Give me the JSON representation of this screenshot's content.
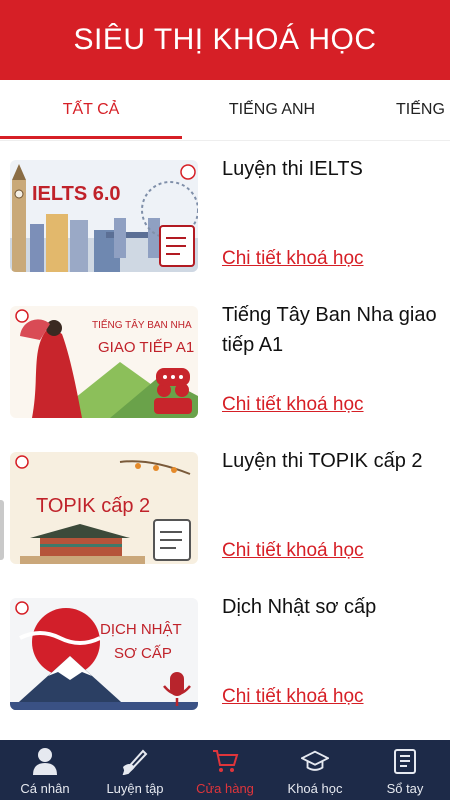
{
  "header": {
    "title": "SIÊU THỊ KHOÁ HỌC"
  },
  "tabs": [
    {
      "label": "TẤT CẢ",
      "active": true
    },
    {
      "label": "TIẾNG ANH",
      "active": false
    },
    {
      "label": "TIẾNG",
      "active": false
    }
  ],
  "courses": [
    {
      "title": "Luyện thi IELTS",
      "link": "Chi tiết khoá học",
      "thumb_text": "IELTS 6.0"
    },
    {
      "title": "Tiếng Tây Ban Nha giao tiếp A1",
      "link": "Chi tiết khoá học",
      "thumb_text_1": "TIẾNG TÂY BAN NHA",
      "thumb_text_2": "GIAO TIẾP A1"
    },
    {
      "title": "Luyện thi TOPIK cấp 2",
      "link": "Chi tiết khoá học",
      "thumb_text": "TOPIK cấp 2"
    },
    {
      "title": "Dịch Nhật sơ cấp",
      "link": "Chi tiết khoá học",
      "thumb_text_1": "DỊCH NHẬT",
      "thumb_text_2": "SƠ CẤP"
    }
  ],
  "bottom_nav": [
    {
      "label": "Cá nhân",
      "icon": "person-icon",
      "active": false
    },
    {
      "label": "Luyện tập",
      "icon": "pen-hand-icon",
      "active": false
    },
    {
      "label": "Cửa hàng",
      "icon": "cart-icon",
      "active": true
    },
    {
      "label": "Khoá học",
      "icon": "graduation-cap-icon",
      "active": false
    },
    {
      "label": "Sổ tay",
      "icon": "notebook-icon",
      "active": false
    }
  ],
  "colors": {
    "brand": "#d61f26",
    "nav_bg": "#1d2a48",
    "nav_active": "#e0353b"
  }
}
